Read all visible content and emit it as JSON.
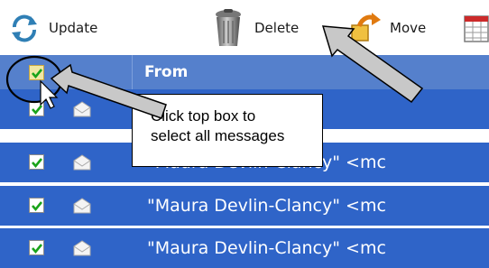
{
  "toolbar": {
    "update_label": "Update",
    "delete_label": "Delete",
    "move_label": "Move"
  },
  "table": {
    "from_header": "From",
    "rows": [
      {
        "sender": "",
        "checked": true
      },
      {
        "sender": "\"Maura Devlin-Clancy\" <mc",
        "checked": true
      },
      {
        "sender": "\"Maura Devlin-Clancy\" <mc",
        "checked": true
      },
      {
        "sender": "\"Maura Devlin-Clancy\" <mc",
        "checked": true
      }
    ]
  },
  "callout": {
    "line1": "Click top box to",
    "line2": "select all messages"
  },
  "colors": {
    "header_bg": "#5580cc",
    "row_selected_bg": "#2f64c8",
    "checkmark": "#1aa31a"
  }
}
